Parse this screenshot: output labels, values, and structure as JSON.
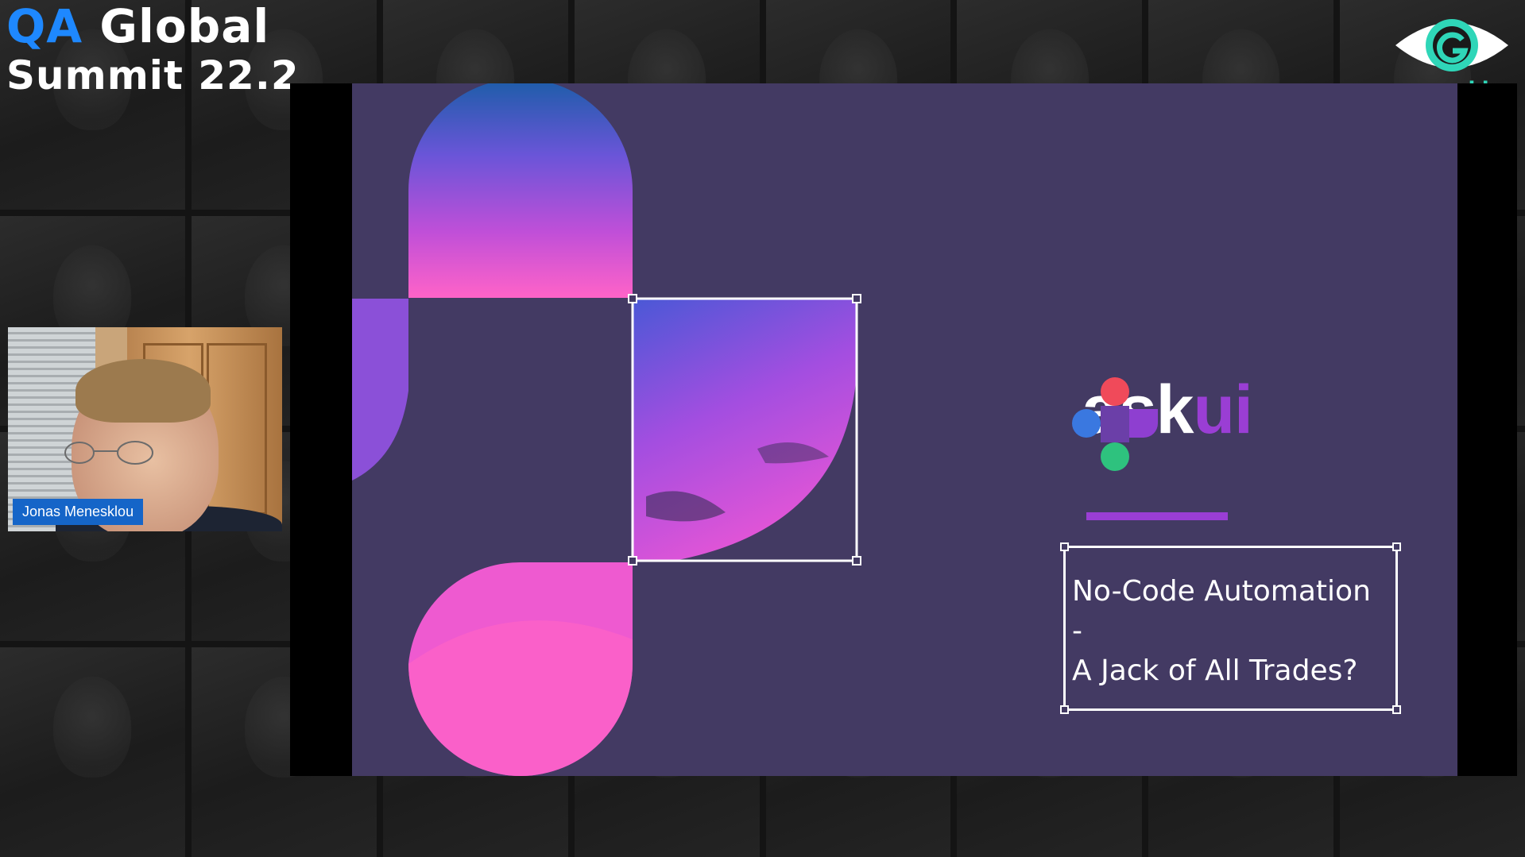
{
  "event": {
    "title_part1": "QA",
    "title_part2": "Global",
    "title_line2": "Summit 22.2"
  },
  "brand": {
    "logo_label_open": "<",
    "logo_label_name": "geekle",
    "logo_label_close": ">"
  },
  "presenter": {
    "name": "Jonas Menesklou"
  },
  "slide": {
    "logo_text_ask": "ask",
    "logo_text_ui": "ui",
    "title_line1": "No-Code Automation",
    "title_line2": "-",
    "title_line3": "A Jack of All Trades?"
  },
  "colors": {
    "slide_bg": "#433a63",
    "accent_purple": "#9a3ed4",
    "qa_blue": "#1e88ff",
    "geekle_teal": "#2fd6b8",
    "nametag_blue": "#1565c8",
    "logo_red": "#f04a5a",
    "logo_blue": "#3a78e0",
    "logo_green": "#2ec27e",
    "logo_purple": "#8e3fd0"
  }
}
